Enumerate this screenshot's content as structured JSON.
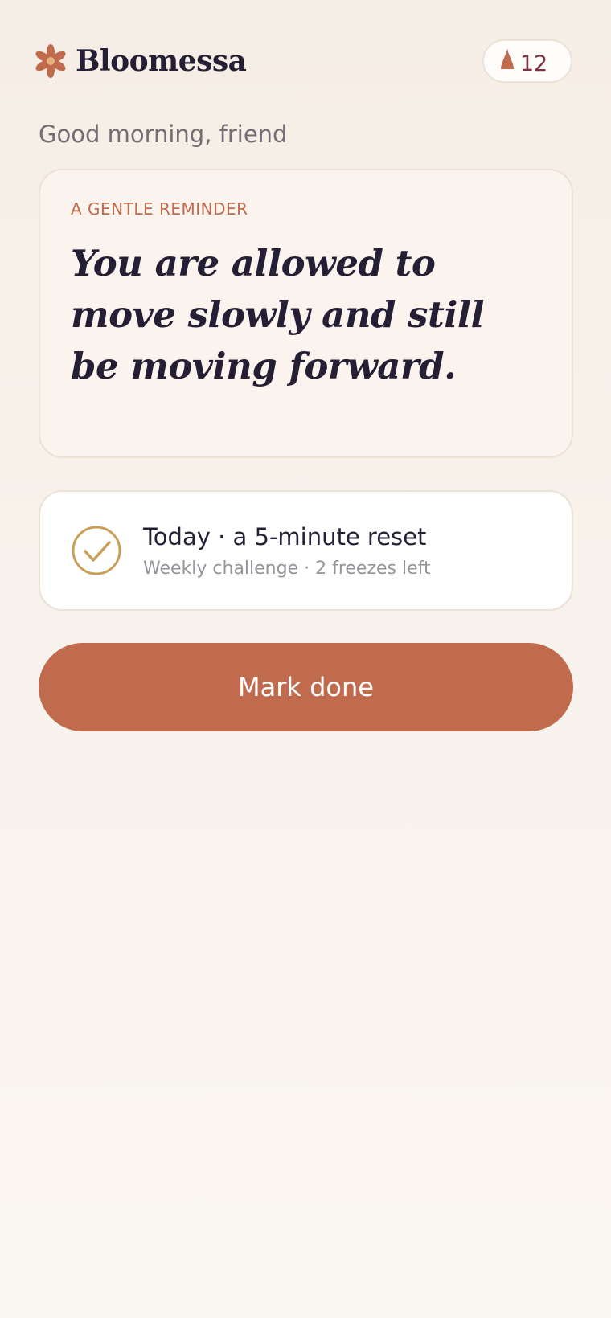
{
  "app": {
    "name": "Bloomessa",
    "logo_icon": "flower-icon",
    "accent_color": "#c06b4e"
  },
  "streak": {
    "icon": "flame-icon",
    "count": "12"
  },
  "greeting": "Good morning, friend",
  "reminder": {
    "eyebrow": "A GENTLE REMINDER",
    "quote": "You are allowed to move slowly and still be moving forward."
  },
  "challenge": {
    "icon": "check-circle-icon",
    "title": "Today · a 5-minute reset",
    "subtitle": "Weekly challenge · 2 freezes left"
  },
  "actions": {
    "mark_done_label": "Mark done"
  }
}
